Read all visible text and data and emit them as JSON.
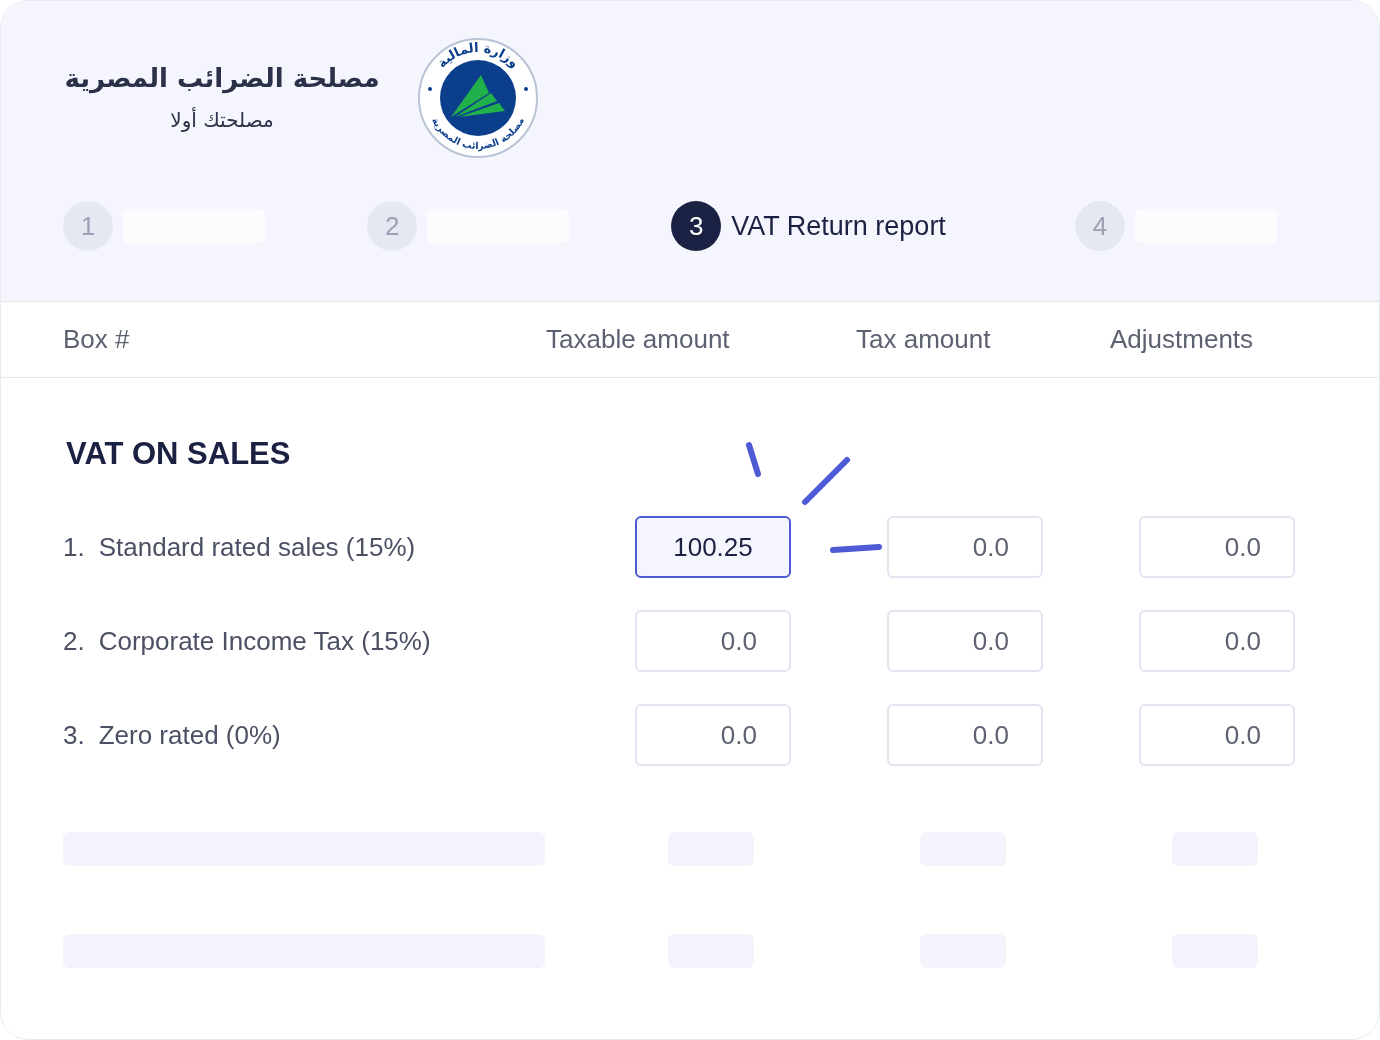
{
  "header": {
    "title": "مصلحة الضرائب المصرية",
    "tagline": "مصلحتك أولا",
    "logo": {
      "top_text": "وزارة المالية",
      "bottom_text": "مصلحة الضرائب المصرية"
    }
  },
  "steps": [
    {
      "number": "1",
      "selected": false
    },
    {
      "number": "2",
      "selected": false
    },
    {
      "number": "3",
      "label": "VAT Return report",
      "selected": true
    },
    {
      "number": "4",
      "selected": false
    }
  ],
  "table": {
    "columns": [
      "Box #",
      "Taxable amount",
      "Tax amount",
      "Adjustments"
    ],
    "section_title": "VAT ON SALES",
    "rows": [
      {
        "number": "1.",
        "label": "Standard rated sales (15%)",
        "values": [
          {
            "value": "100.25",
            "focused": true
          },
          {
            "value": "0.0",
            "focused": false
          },
          {
            "value": "0.0",
            "focused": false
          }
        ]
      },
      {
        "number": "2.",
        "label": "Corporate Income Tax (15%)",
        "values": [
          {
            "value": "0.0",
            "focused": false
          },
          {
            "value": "0.0",
            "focused": false
          },
          {
            "value": "0.0",
            "focused": false
          }
        ]
      },
      {
        "number": "3.",
        "label": "Zero rated (0%)",
        "values": [
          {
            "value": "0.0",
            "focused": false
          },
          {
            "value": "0.0",
            "focused": false
          },
          {
            "value": "0.0",
            "focused": false
          }
        ]
      }
    ],
    "skeleton_rows": [
      {
        "kind": "skeleton"
      },
      {
        "kind": "skeleton"
      }
    ]
  }
}
